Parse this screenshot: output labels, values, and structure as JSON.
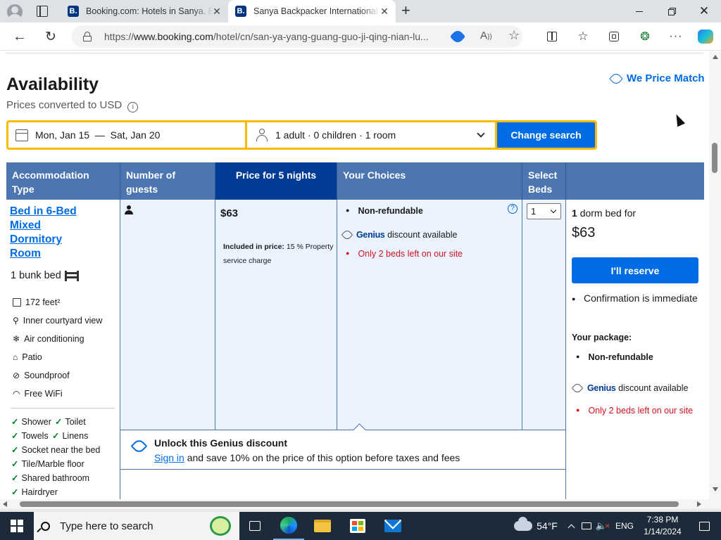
{
  "browser": {
    "tabs": [
      {
        "title": "Booking.com: Hotels in Sanya. Bo",
        "favicon": "B.",
        "active": false
      },
      {
        "title": "Sanya Backpacker International Y",
        "favicon": "B.",
        "active": true
      }
    ],
    "url_prefix": "https://",
    "url_main": "www.booking.com",
    "url_rest": "/hotel/cn/san-ya-yang-guang-guo-ji-qing-nian-lu..."
  },
  "page": {
    "title": "Availability",
    "subtitle": "Prices converted to USD",
    "price_match": "We Price Match",
    "search": {
      "dates": "Mon, Jan 15  —  Sat, Jan 20",
      "guests": "1 adult · 0 children · 1 room",
      "button": "Change search"
    },
    "table": {
      "headers": {
        "type": "Accommodation Type",
        "guests": "Number of guests",
        "price": "Price for 5 nights",
        "choices": "Your Choices",
        "select": "Select Beds"
      },
      "room": {
        "name": "Bed in 6-Bed Mixed Dormitory Room",
        "bed": "1 bunk bed",
        "size": "172 feet²",
        "amenities": [
          "Inner courtyard view",
          "Air conditioning",
          "Patio",
          "Soundproof",
          "Free WiFi"
        ],
        "checks": [
          [
            "Shower",
            "Toilet"
          ],
          [
            "Towels",
            "Linens"
          ],
          [
            "Socket near the bed"
          ],
          [
            "Tile/Marble floor"
          ],
          [
            "Shared bathroom"
          ],
          [
            "Hairdryer"
          ]
        ],
        "price": "$63",
        "included_label": "Included in price:",
        "included_text": "15 % Property service charge",
        "choice_nonrefundable": "Non-refundable",
        "genius_word": "Genius",
        "genius_rest": "discount available",
        "scarcity": "Only 2 beds left on our site",
        "select_value": "1"
      },
      "reserve": {
        "count": "1",
        "count_rest": "dorm bed for",
        "price": "$63",
        "button": "I'll reserve",
        "confirmation": "Confirmation is immediate",
        "package_label": "Your package:",
        "package_item": "Non-refundable",
        "genius_word": "Genius",
        "genius_rest": "discount available",
        "scarcity": "Only 2 beds left on our site"
      }
    },
    "unlock": {
      "title": "Unlock this Genius discount",
      "link": "Sign in",
      "rest": "and save 10% on the price of this option before taxes and fees"
    }
  },
  "taskbar": {
    "search_placeholder": "Type here to search",
    "weather": "54°F",
    "language": "ENG",
    "time": "7:38 PM",
    "date": "1/14/2024"
  },
  "colors": {
    "brand_blue": "#006ce4",
    "header_blue": "#4c76b2",
    "selected_header": "#003b95",
    "genius_blue": "#003b95",
    "scarcity_red": "#d4111e",
    "search_yellow": "#febb02"
  }
}
